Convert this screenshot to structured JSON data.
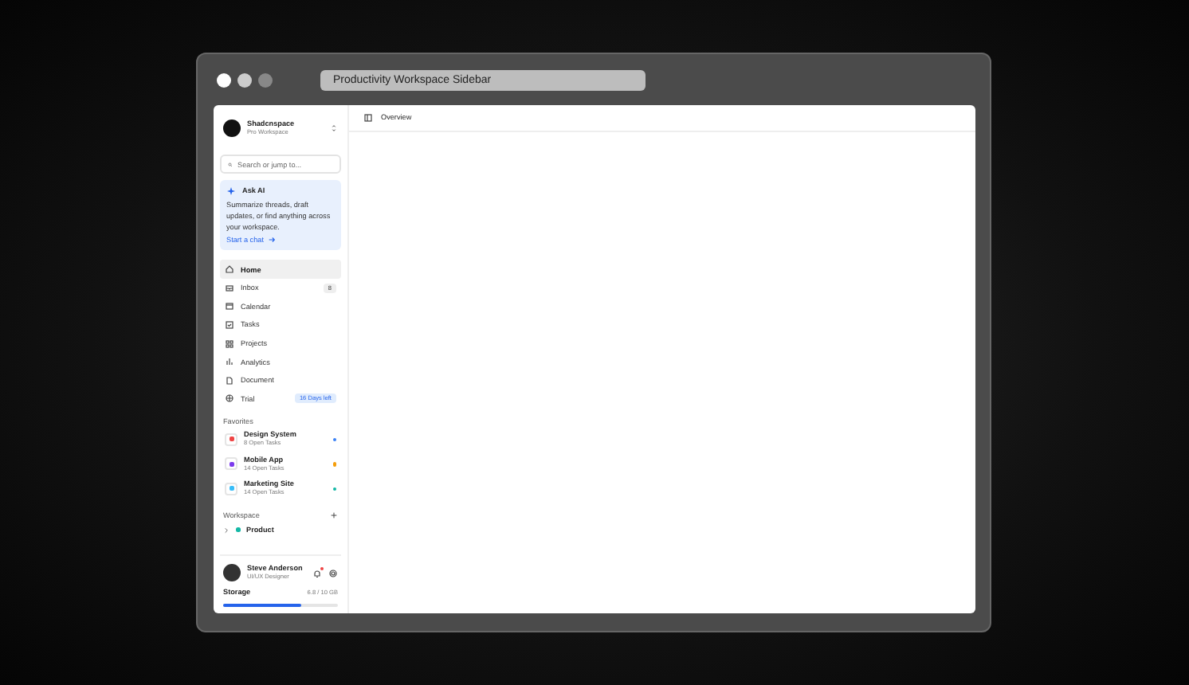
{
  "window": {
    "title": "Productivity Workspace Sidebar"
  },
  "workspace": {
    "name": "Shadcnspace",
    "plan": "Pro Workspace"
  },
  "search": {
    "placeholder": "Search or jump to..."
  },
  "ai_card": {
    "title": "Ask AI",
    "text": "Summarize threads, draft updates, or find anything across your workspace.",
    "link": "Start a chat"
  },
  "nav": [
    {
      "label": "Home",
      "selected": true
    },
    {
      "label": "Inbox",
      "selected": false,
      "badge": {
        "text": "8",
        "kind": "count"
      }
    },
    {
      "label": "Calendar",
      "selected": false
    },
    {
      "label": "Tasks",
      "selected": false
    },
    {
      "label": "Projects",
      "selected": false
    },
    {
      "label": "Analytics",
      "selected": false
    },
    {
      "label": "Document",
      "selected": false
    },
    {
      "label": "Trial",
      "selected": false,
      "badge": {
        "text": "16 Days left",
        "kind": "info"
      }
    }
  ],
  "favorites": {
    "title": "Favorites",
    "items": [
      {
        "name": "Design System",
        "meta": "8 Open Tasks",
        "color": "#3b82f6",
        "icon": {
          "color": "#ef4444"
        }
      },
      {
        "name": "Mobile App",
        "meta": "14 Open Tasks",
        "color": "#f59e0b",
        "icon": {
          "color": "#7c3aed"
        }
      },
      {
        "name": "Marketing Site",
        "meta": "14 Open Tasks",
        "color": "#14b8a6",
        "icon": {
          "color": "#38bdf8"
        }
      }
    ]
  },
  "workspace_section": {
    "title": "Workspace",
    "items": [
      {
        "name": "Product",
        "color": "#14b8a6"
      }
    ]
  },
  "user": {
    "name": "Steve Anderson",
    "role": "UI/UX Designer",
    "has_notification": true
  },
  "storage": {
    "label": "Storage",
    "reading": "6.8 / 10 GB",
    "level": 0.68
  },
  "main": {
    "title": "Overview"
  }
}
